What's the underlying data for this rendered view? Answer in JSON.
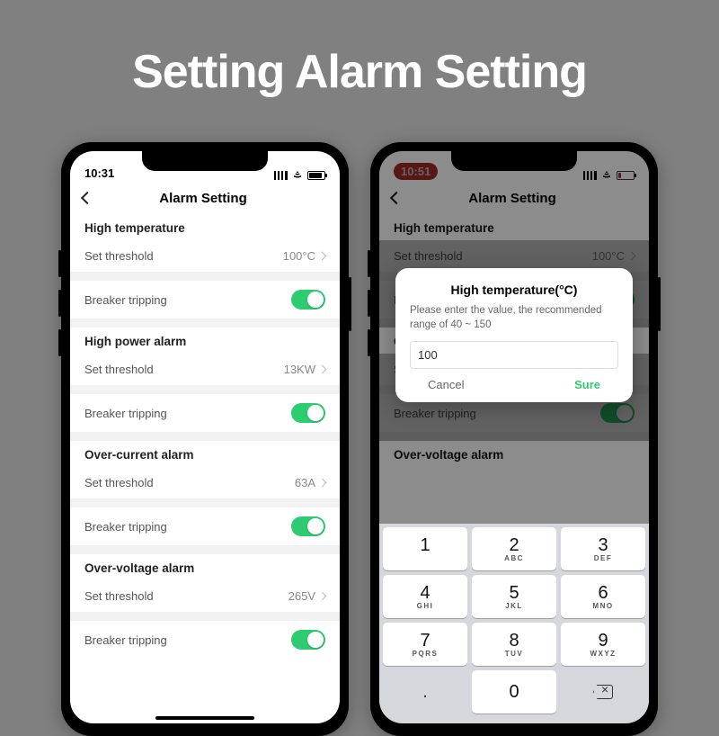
{
  "hero_title": "Setting Alarm Setting",
  "phone1": {
    "time": "10:31",
    "nav_title": "Alarm Setting",
    "sections": {
      "high_temp": {
        "title": "High temperature",
        "threshold_label": "Set threshold",
        "threshold_value": "100°C",
        "tripping_label": "Breaker tripping"
      },
      "high_power": {
        "title": "High power alarm",
        "threshold_label": "Set threshold",
        "threshold_value": "13KW",
        "tripping_label": "Breaker tripping"
      },
      "over_current": {
        "title": "Over-current alarm",
        "threshold_label": "Set threshold",
        "threshold_value": "63A",
        "tripping_label": "Breaker tripping"
      },
      "over_voltage": {
        "title": "Over-voltage alarm",
        "threshold_label": "Set threshold",
        "threshold_value": "265V",
        "tripping_label": "Breaker tripping"
      }
    }
  },
  "phone2": {
    "time": "10:51",
    "nav_title": "Alarm Setting",
    "bg": {
      "s1_title": "High temperature",
      "s1_threshold_label": "Set threshold",
      "s1_threshold_value": "100°C",
      "s2_threshold_label": "Set threshold",
      "s2_tripping_label": "Breaker tripping",
      "s3_title": "Over-voltage alarm"
    },
    "dialog": {
      "title": "High temperature(°C)",
      "message": "Please enter the value, the recommended range of 40 ~ 150",
      "input_value": "100",
      "cancel": "Cancel",
      "sure": "Sure"
    },
    "keypad": {
      "k1": "1",
      "k2": "2",
      "k2s": "ABC",
      "k3": "3",
      "k3s": "DEF",
      "k4": "4",
      "k4s": "GHI",
      "k5": "5",
      "k5s": "JKL",
      "k6": "6",
      "k6s": "MNO",
      "k7": "7",
      "k7s": "PQRS",
      "k8": "8",
      "k8s": "TUV",
      "k9": "9",
      "k9s": "WXYZ",
      "kdot": ".",
      "k0": "0"
    }
  }
}
